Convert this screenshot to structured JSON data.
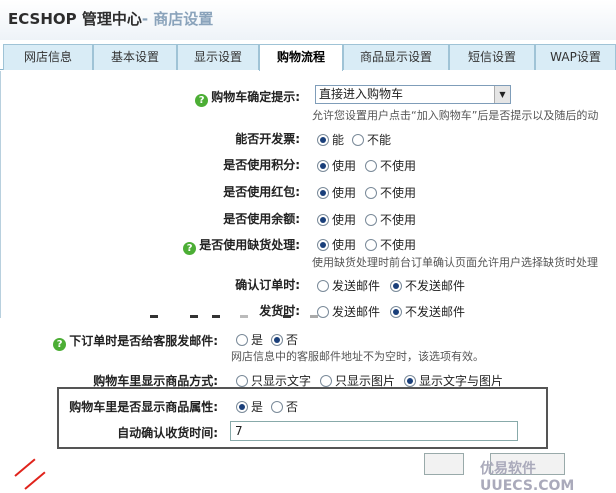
{
  "header": {
    "app": "ECSHOP 管理中心",
    "section": "- 商店设置"
  },
  "tabs": [
    "网店信息",
    "基本设置",
    "显示设置",
    "购物流程",
    "商品显示设置",
    "短信设置",
    "WAP设置"
  ],
  "form": {
    "cart_confirm": {
      "label": "购物车确定提示:",
      "value": "直接进入购物车",
      "note": "允许您设置用户点击“加入购物车”后是否提示以及随后的动"
    },
    "invoice": {
      "label": "能否开发票:",
      "options": [
        "能",
        "不能"
      ]
    },
    "points": {
      "label": "是否使用积分:",
      "options": [
        "使用",
        "不使用"
      ]
    },
    "bonus": {
      "label": "是否使用红包:",
      "options": [
        "使用",
        "不使用"
      ]
    },
    "balance": {
      "label": "是否使用余额:",
      "options": [
        "使用",
        "不使用"
      ]
    },
    "stock": {
      "label": "是否使用缺货处理:",
      "options": [
        "使用",
        "不使用"
      ],
      "note": "使用缺货处理时前台订单确认页面允许用户选择缺货时处理"
    },
    "confirm_order": {
      "label": "确认订单时:",
      "options": [
        "发送邮件",
        "不发送邮件"
      ]
    },
    "ship": {
      "label": "发货时:",
      "options": [
        "发送邮件",
        "不发送邮件"
      ]
    },
    "order_mail": {
      "label": "下订单时是否给客服发邮件:",
      "options": [
        "是",
        "否"
      ],
      "note": "网店信息中的客服邮件地址不为空时，该选项有效。"
    },
    "cart_show": {
      "label": "购物车里显示商品方式:",
      "options": [
        "只显示文字",
        "只显示图片",
        "显示文字与图片"
      ]
    },
    "cart_attr": {
      "label": "购物车里是否显示商品属性:",
      "options": [
        "是",
        "否"
      ]
    },
    "auto_receive": {
      "label": "自动确认收货时间:",
      "value": "7"
    }
  },
  "watermark": "优易软件 UUECS.COM"
}
